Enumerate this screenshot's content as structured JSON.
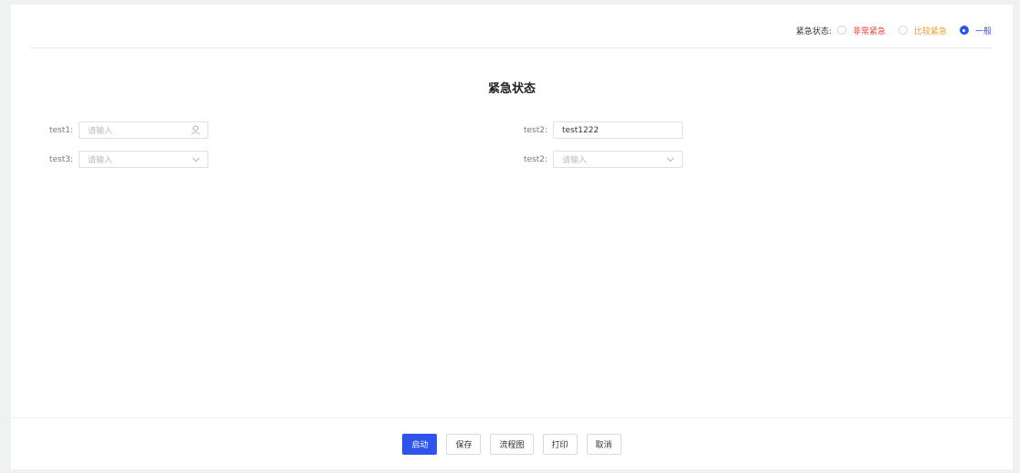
{
  "urgency": {
    "label": "紧急状态:",
    "options": [
      {
        "label": "非常紧急",
        "color": "#e8453c",
        "checked": false
      },
      {
        "label": "比较紧急",
        "color": "#f59a23",
        "checked": false
      },
      {
        "label": "一般",
        "color": "#2f54eb",
        "checked": true
      }
    ]
  },
  "form": {
    "title": "紧急状态",
    "fields": {
      "test1": {
        "label": "test1:",
        "placeholder": "请输入",
        "value": "",
        "icon": "user-icon"
      },
      "test2": {
        "label": "test2:",
        "placeholder": "",
        "value": "test1222"
      },
      "test3": {
        "label": "test3:",
        "placeholder": "请输入",
        "value": "",
        "icon": "chevron-down-icon"
      },
      "test2b": {
        "label": "test2:",
        "placeholder": "请输入",
        "value": "",
        "icon": "chevron-down-icon"
      }
    }
  },
  "footer": {
    "start": "启动",
    "save": "保存",
    "flowchart": "流程图",
    "print": "打印",
    "cancel": "取消",
    "primary_color": "#2f54eb"
  }
}
